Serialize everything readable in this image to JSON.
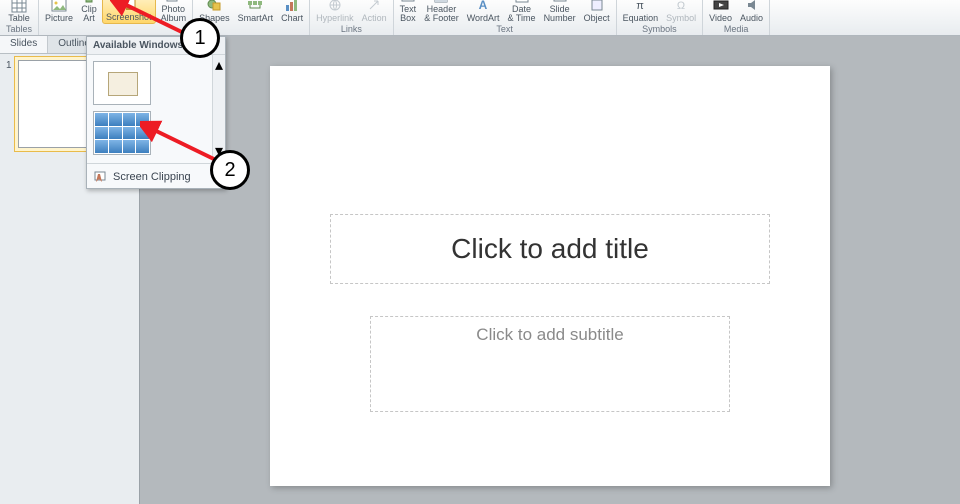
{
  "ribbon": {
    "groups": {
      "tables": {
        "label": "Tables",
        "items": [
          {
            "label": "Table"
          }
        ]
      },
      "images": {
        "label": "",
        "items": [
          {
            "label": "Picture"
          },
          {
            "label": "Clip\nArt"
          },
          {
            "label": "Screenshot"
          },
          {
            "label": "Photo\nAlbum"
          }
        ]
      },
      "illustrations": {
        "label": "",
        "items": [
          {
            "label": "Shapes"
          },
          {
            "label": "SmartArt"
          },
          {
            "label": "Chart"
          }
        ]
      },
      "links": {
        "label": "Links",
        "items": [
          {
            "label": "Hyperlink"
          },
          {
            "label": "Action"
          }
        ]
      },
      "text": {
        "label": "Text",
        "items": [
          {
            "label": "Text\nBox"
          },
          {
            "label": "Header\n& Footer"
          },
          {
            "label": "WordArt"
          },
          {
            "label": "Date\n& Time"
          },
          {
            "label": "Slide\nNumber"
          },
          {
            "label": "Object"
          }
        ]
      },
      "symbols": {
        "label": "Symbols",
        "items": [
          {
            "label": "Equation"
          },
          {
            "label": "Symbol"
          }
        ]
      },
      "media": {
        "label": "Media",
        "items": [
          {
            "label": "Video"
          },
          {
            "label": "Audio"
          }
        ]
      }
    }
  },
  "sidepane": {
    "tabs": {
      "slides": "Slides",
      "outline": "Outline"
    },
    "thumb_number": "1"
  },
  "dropdown": {
    "heading": "Available Windows",
    "screen_clipping": "Screen Clipping"
  },
  "slide": {
    "title_placeholder": "Click to add title",
    "subtitle_placeholder": "Click to add subtitle"
  },
  "annotations": {
    "one": "1",
    "two": "2"
  }
}
